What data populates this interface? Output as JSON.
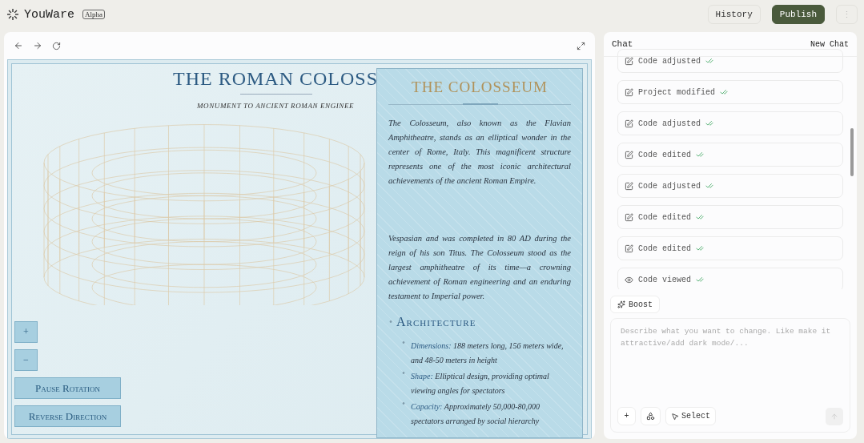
{
  "app": {
    "name": "YouWare",
    "badge": "Alpha"
  },
  "header_buttons": [
    {
      "label": "History",
      "kind": "outline"
    },
    {
      "label": "Publish",
      "kind": "primary"
    },
    {
      "label": "⋮",
      "kind": "icon"
    }
  ],
  "preview": {
    "title": "THE ROMAN COLOSS",
    "subtitle": "MONUMENT TO ANCIENT ROMAN ENGINEE",
    "controls": [
      {
        "label": "+",
        "kind": "small"
      },
      {
        "label": "−",
        "kind": "small"
      },
      {
        "label": "Pause Rotation",
        "kind": "wide"
      },
      {
        "label": "Reverse Direction",
        "kind": "wide"
      }
    ],
    "panel": {
      "title": "THE COLOSSEUM",
      "paragraphs": [
        "The Colosseum, also known as the Flavian Amphitheatre, stands as an elliptical wonder in the center of Rome, Italy. This magnificent structure represents one of the most iconic architectural achievements of the ancient Roman Empire.",
        "Vespasian and was completed in 80 AD during the reign of his son Titus. The Colosseum stood as the largest amphitheatre of its time—a crowning achievement of Roman engineering and an enduring testament to Imperial power."
      ],
      "marker": "•",
      "section": "Architecture",
      "facts": [
        {
          "label": "Dimensions:",
          "text": "188 meters long, 156 meters wide, and 48-50 meters in height"
        },
        {
          "label": "Shape:",
          "text": "Elliptical design, providing optimal viewing angles for spectators"
        },
        {
          "label": "Capacity:",
          "text": "Approximately 50,000-80,000 spectators arranged by social hierarchy"
        }
      ]
    }
  },
  "chat": {
    "title": "Chat",
    "new_chat": "New Chat",
    "items": [
      {
        "label": "Code adjusted",
        "kind": "edit"
      },
      {
        "label": "Project modified",
        "kind": "edit"
      },
      {
        "label": "Code adjusted",
        "kind": "edit"
      },
      {
        "label": "Code edited",
        "kind": "edit"
      },
      {
        "label": "Code adjusted",
        "kind": "edit"
      },
      {
        "label": "Code edited",
        "kind": "edit"
      },
      {
        "label": "Code edited",
        "kind": "edit"
      },
      {
        "label": "Code viewed",
        "kind": "view"
      }
    ],
    "boost": "Boost",
    "input": {
      "placeholder": "Describe what you want to change. Like make it attractive/add dark mode/..."
    },
    "tools": [
      {
        "label": "+",
        "kind": "plus"
      },
      {
        "kind": "shapes"
      },
      {
        "label": "Select",
        "kind": "select"
      }
    ]
  }
}
